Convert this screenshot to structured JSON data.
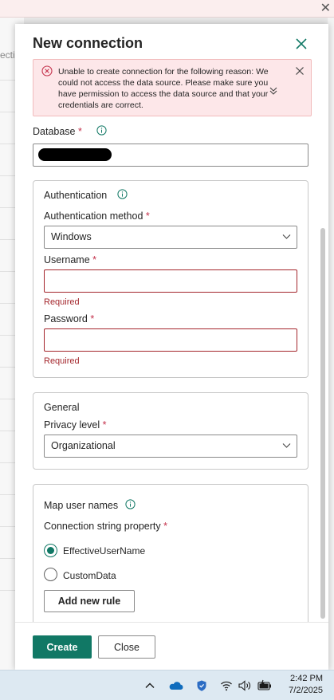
{
  "background": {
    "left_text": "ectic"
  },
  "dialog": {
    "title": "New connection",
    "error": {
      "message": "Unable to create connection for the following reason: We could not access the data source. Please make sure you have permission to access the data source and that your credentials are correct."
    },
    "database": {
      "label": "Database",
      "required_mark": "*"
    },
    "authentication": {
      "title": "Authentication",
      "method_label": "Authentication method",
      "method_value": "Windows",
      "username_label": "Username",
      "username_value": "",
      "password_label": "Password",
      "password_value": "",
      "required_text": "Required",
      "required_mark": "*"
    },
    "general": {
      "title": "General",
      "privacy_label": "Privacy level",
      "privacy_value": "Organizational"
    },
    "map_user_names": {
      "title": "Map user names",
      "property_label": "Connection string property",
      "options": [
        "EffectiveUserName",
        "CustomData"
      ],
      "selected": "EffectiveUserName",
      "add_rule_label": "Add new rule"
    },
    "buttons": {
      "create": "Create",
      "close": "Close"
    }
  },
  "taskbar": {
    "time": "2:42 PM",
    "date": "7/2/2025"
  },
  "colors": {
    "accent": "#117865",
    "error": "#a4262c",
    "error_bg": "#fde7e9"
  }
}
